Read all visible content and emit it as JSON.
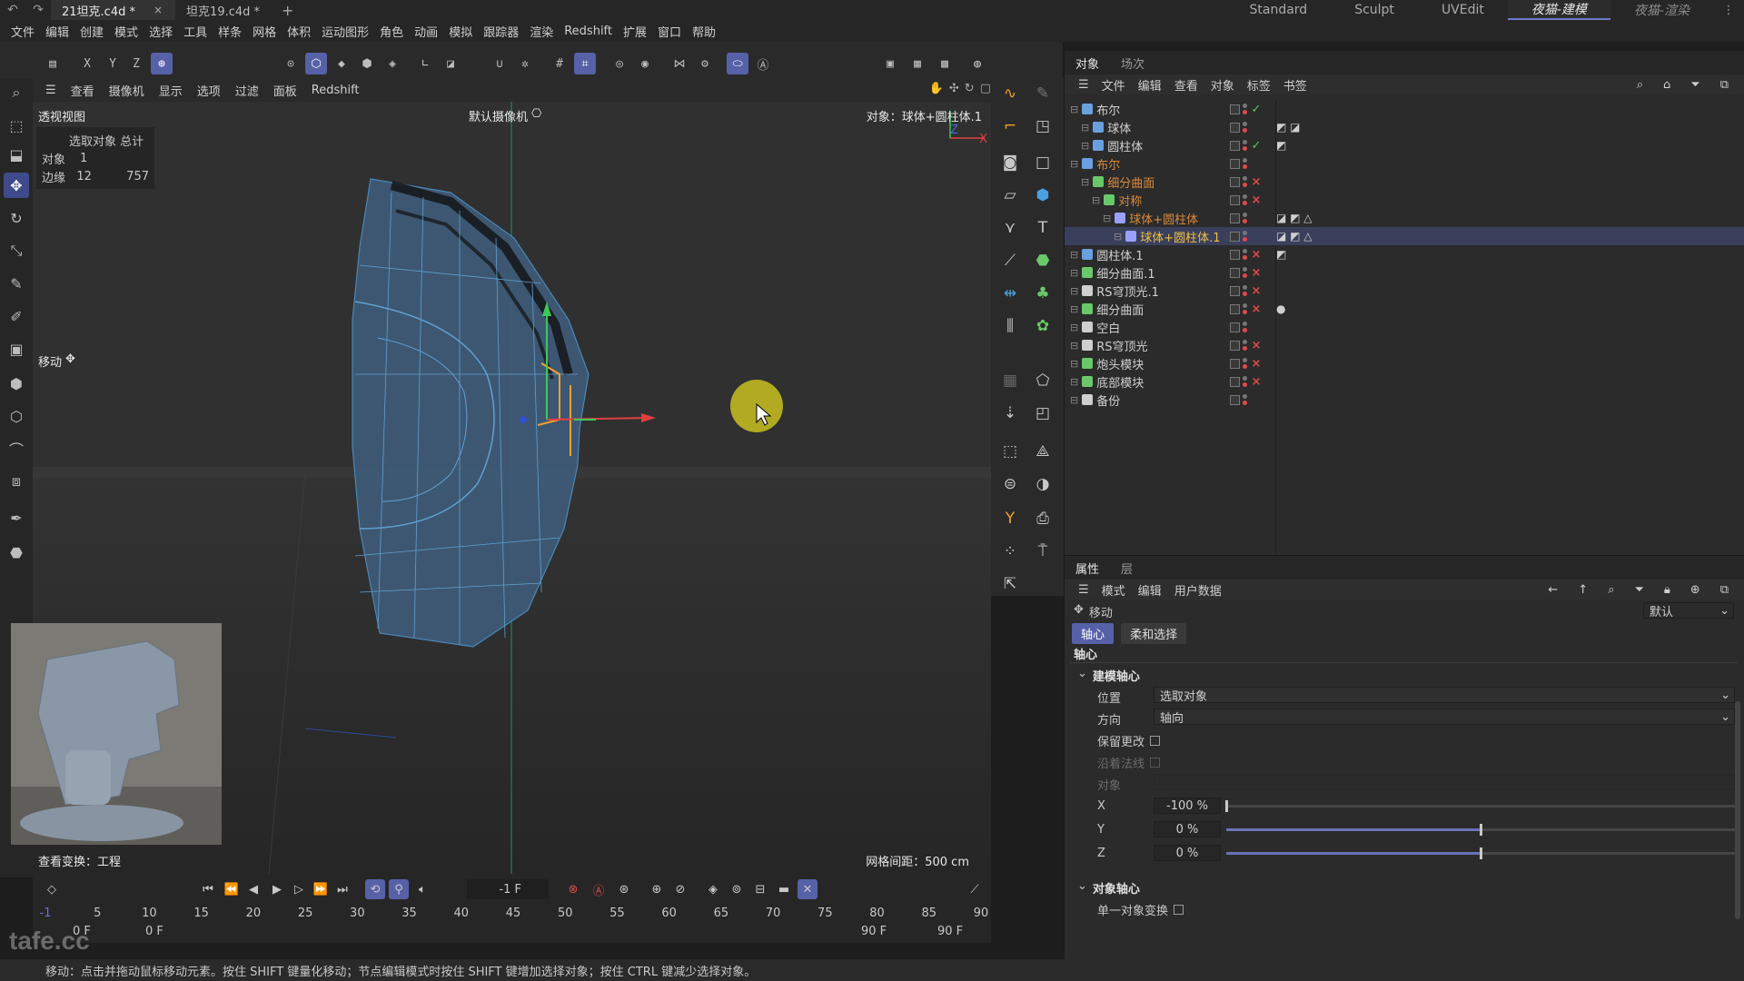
{
  "titlebar": {
    "tabs": [
      {
        "label": "21坦克.c4d *",
        "active": true
      },
      {
        "label": "坦克19.c4d *",
        "active": false
      }
    ],
    "close_glyph": "×",
    "new_tab_glyph": "+",
    "layouts": [
      "Standard",
      "Sculpt",
      "UVEdit",
      "夜猫-建模",
      "夜猫-渲染"
    ],
    "active_layout": "夜猫-建模"
  },
  "menu": [
    "文件",
    "编辑",
    "创建",
    "模式",
    "选择",
    "工具",
    "样条",
    "网格",
    "体积",
    "运动图形",
    "角色",
    "动画",
    "模拟",
    "跟踪器",
    "渲染",
    "Redshift",
    "扩展",
    "窗口",
    "帮助"
  ],
  "toolbar": {
    "axis_x": "X",
    "axis_y": "Y",
    "axis_z": "Z"
  },
  "viewport": {
    "menu": [
      "查看",
      "摄像机",
      "显示",
      "选项",
      "过滤",
      "面板",
      "Redshift"
    ],
    "view_name": "透视视图",
    "camera": "默认摄像机",
    "object_label": "对象：球体+圆柱体.1",
    "hud": {
      "header": "选取对象 总计",
      "row1_label": "对象",
      "row1_value": "1",
      "row2_label": "边缘",
      "row2_value": "12",
      "row2_total": "757"
    },
    "tool_label": "移动",
    "view_transform": "查看变换：工程",
    "grid_spacing": "网格间距：500 cm",
    "axis_gizmo_z": "Z",
    "axis_gizmo_x": "X"
  },
  "timeline": {
    "current_frame": "-1 F",
    "ruler": [
      "-1",
      "5",
      "10",
      "15",
      "20",
      "25",
      "30",
      "35",
      "40",
      "45",
      "50",
      "55",
      "60",
      "65",
      "70",
      "75",
      "80",
      "85",
      "90"
    ],
    "start_a": "0 F",
    "start_b": "0 F",
    "end_a": "90 F",
    "end_b": "90 F"
  },
  "status": "移动：点击并拖动鼠标移动元素。按住 SHIFT 键量化移动；节点编辑模式时按住 SHIFT 键增加选择对象；按住 CTRL 键减少选择对象。",
  "watermark": "tafe.cc",
  "object_manager": {
    "tabs": [
      "对象",
      "场次"
    ],
    "menu": [
      "文件",
      "编辑",
      "查看",
      "对象",
      "标签",
      "书签"
    ],
    "rows": [
      {
        "name": "布尔",
        "indent": 0,
        "color": "#d0d0d0",
        "icon": "boole-icon",
        "status": "✓",
        "status_color": "#5ac85a"
      },
      {
        "name": "球体",
        "indent": 1,
        "color": "#d0d0d0",
        "icon": "sphere-icon",
        "status": "",
        "status_color": "",
        "tags": "◩ ◪"
      },
      {
        "name": "圆柱体",
        "indent": 1,
        "color": "#d0d0d0",
        "icon": "cylinder-icon",
        "status": "✓",
        "status_color": "#5ac85a",
        "tags": "◩"
      },
      {
        "name": "布尔",
        "indent": 0,
        "color": "#d98a3c",
        "icon": "boole-icon",
        "status": "",
        "status_color": ""
      },
      {
        "name": "细分曲面",
        "indent": 1,
        "color": "#d98a3c",
        "icon": "subdivision-icon",
        "status": "×",
        "status_color": "#e04a4a"
      },
      {
        "name": "对称",
        "indent": 2,
        "color": "#d98a3c",
        "icon": "symmetry-icon",
        "status": "×",
        "status_color": "#e04a4a"
      },
      {
        "name": "球体+圆柱体",
        "indent": 3,
        "color": "#d98a3c",
        "icon": "polygon-icon",
        "status": "",
        "status_color": "",
        "tags": "◪ ◩ △"
      },
      {
        "name": "球体+圆柱体.1",
        "indent": 4,
        "color": "#f0c040",
        "icon": "polygon-icon",
        "status": "",
        "status_color": "",
        "tags": "◪ ◩ △"
      },
      {
        "name": "圆柱体.1",
        "indent": 0,
        "color": "#d0d0d0",
        "icon": "cylinder-icon",
        "status": "×",
        "status_color": "#e04a4a",
        "tags": "◩"
      },
      {
        "name": "细分曲面.1",
        "indent": 0,
        "color": "#d0d0d0",
        "icon": "subdivision-icon",
        "status": "×",
        "status_color": "#e04a4a"
      },
      {
        "name": "RS穹顶光.1",
        "indent": 0,
        "color": "#d0d0d0",
        "icon": "dome-light-icon",
        "status": "×",
        "status_color": "#e04a4a"
      },
      {
        "name": "细分曲面",
        "indent": 0,
        "color": "#d0d0d0",
        "icon": "subdivision-icon",
        "status": "×",
        "status_color": "#e04a4a",
        "tags": "●"
      },
      {
        "name": "空白",
        "indent": 0,
        "color": "#d0d0d0",
        "icon": "null-icon",
        "status": "",
        "status_color": ""
      },
      {
        "name": "RS穹顶光",
        "indent": 0,
        "color": "#d0d0d0",
        "icon": "dome-light-icon",
        "status": "×",
        "status_color": "#e04a4a"
      },
      {
        "name": "炮头模块",
        "indent": 0,
        "color": "#d0d0d0",
        "icon": "subdivision-icon",
        "status": "×",
        "status_color": "#e04a4a"
      },
      {
        "name": "底部模块",
        "indent": 0,
        "color": "#d0d0d0",
        "icon": "subdivision-icon",
        "status": "×",
        "status_color": "#e04a4a"
      },
      {
        "name": "备份",
        "indent": 0,
        "color": "#d0d0d0",
        "icon": "null-icon",
        "status": "",
        "status_color": ""
      }
    ]
  },
  "attributes": {
    "tabs": [
      "属性",
      "层"
    ],
    "menu": [
      "模式",
      "编辑",
      "用户数据"
    ],
    "tool_name": "移动",
    "preset": "默认",
    "subtabs": [
      "轴心",
      "柔和选择"
    ],
    "section": "轴心",
    "group_modeling": "建模轴心",
    "position_label": "位置",
    "position_value": "选取对象",
    "direction_label": "方向",
    "direction_value": "轴向",
    "keep_changes": "保留更改",
    "along_normal": "沿着法线",
    "object_label": "对象",
    "x_label": "X",
    "x_value": "-100 %",
    "x_fraction": -1.0,
    "y_label": "Y",
    "y_value": "0 %",
    "y_fraction": 0.0,
    "z_label": "Z",
    "z_value": "0 %",
    "z_fraction": 0.0,
    "group_object": "对象轴心",
    "single_transform": "单一对象变换"
  },
  "colors": {
    "accent": "#5661a8",
    "selected_name": "#f0c040",
    "child_name": "#d98a3c",
    "ok": "#5ac85a",
    "off": "#e04a4a"
  }
}
